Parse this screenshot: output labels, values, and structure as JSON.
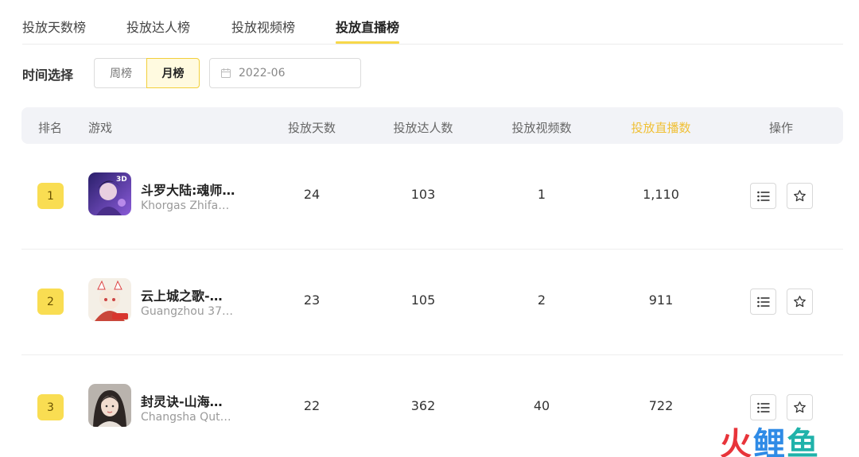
{
  "tabs": [
    "投放天数榜",
    "投放达人榜",
    "投放视频榜",
    "投放直播榜"
  ],
  "active_tab": "投放直播榜",
  "filter": {
    "label": "时间选择",
    "week": "周榜",
    "month": "月榜",
    "selected": "月榜",
    "date": "2022-06"
  },
  "table": {
    "headers": {
      "rank": "排名",
      "game": "游戏",
      "days": "投放天数",
      "creators": "投放达人数",
      "videos": "投放视频数",
      "lives": "投放直播数",
      "ops": "操作"
    },
    "highlight_header": "投放直播数",
    "rows": [
      {
        "rank": "1",
        "name": "斗罗大陆:魂师…",
        "company": "Khorgas Zhifa…",
        "days": "24",
        "creators": "103",
        "videos": "1",
        "lives": "1,110"
      },
      {
        "rank": "2",
        "name": "云上城之歌-…",
        "company": "Guangzhou 37…",
        "days": "23",
        "creators": "105",
        "videos": "2",
        "lives": "911"
      },
      {
        "rank": "3",
        "name": "封灵诀-山海…",
        "company": "Changsha Qut…",
        "days": "22",
        "creators": "362",
        "videos": "40",
        "lives": "722"
      }
    ]
  },
  "watermark": [
    "火",
    "鲤",
    "鱼"
  ],
  "colors": {
    "accent": "#f9dd52",
    "highlight_text": "#f0c036",
    "header_bg": "#f2f3f7"
  },
  "icons": [
    "calendar-icon",
    "list-icon",
    "star-icon"
  ]
}
